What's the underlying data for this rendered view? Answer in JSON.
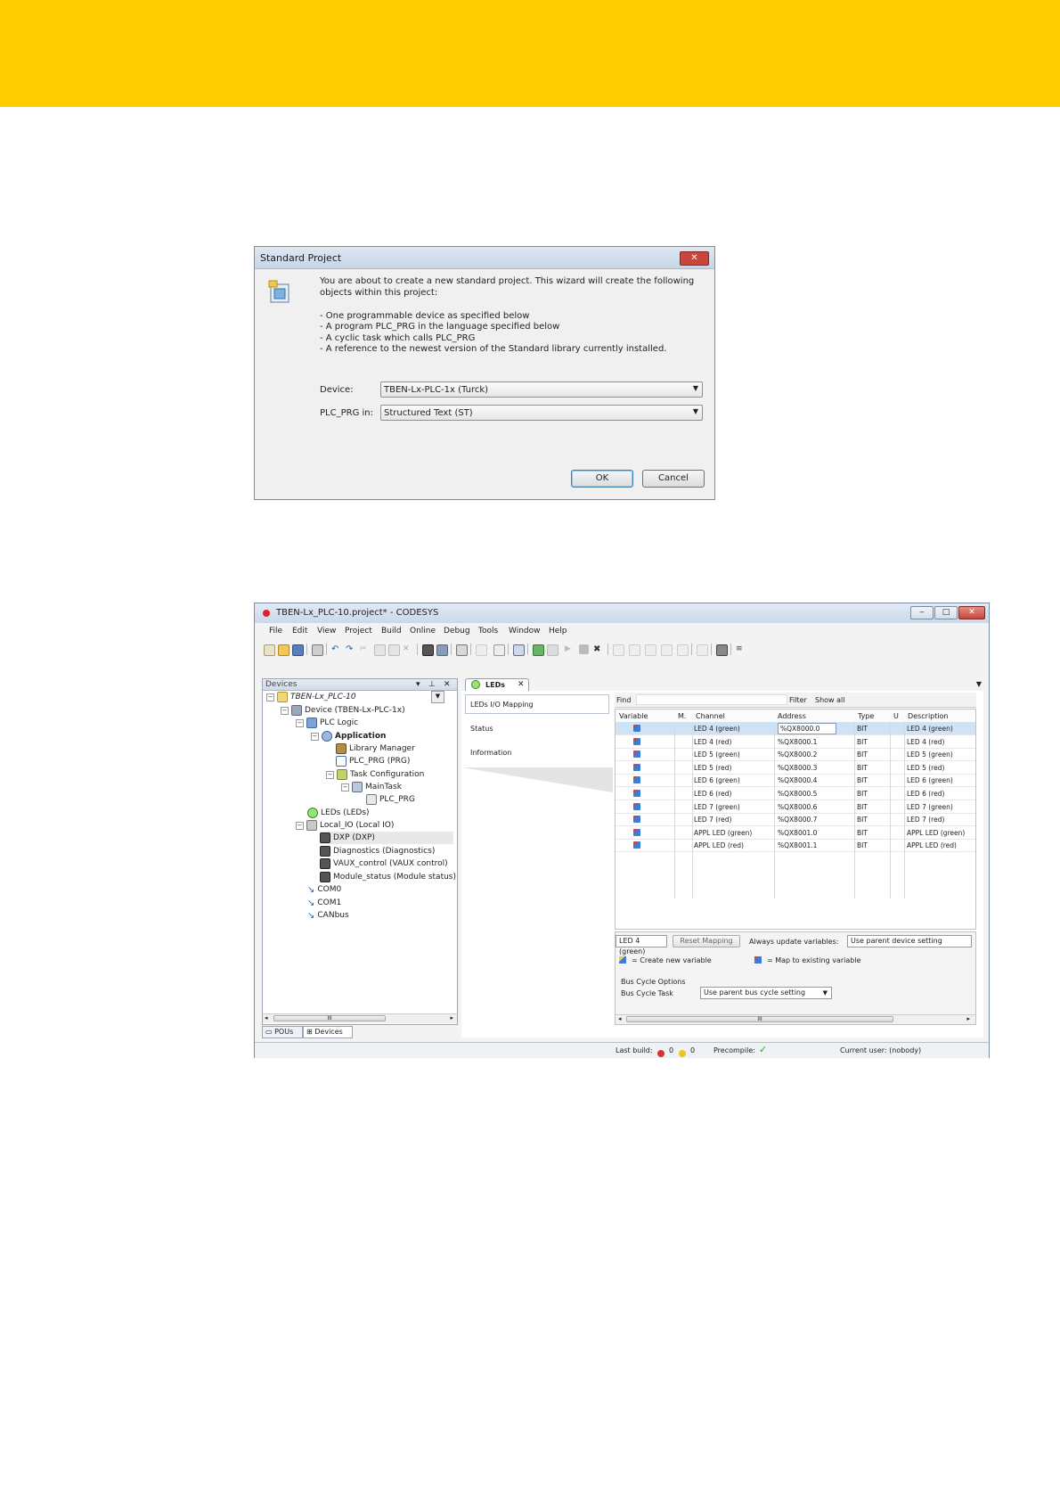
{
  "colors": {
    "banner": "#ffcc00",
    "accent": "#3c7fb1",
    "close": "#c9463d"
  },
  "dialog": {
    "title": "Standard Project",
    "close_label": "✕",
    "intro_1": "You are about to create a new standard project. This wizard will create the following",
    "intro_2": "objects within this project:",
    "bullet_1": "- One programmable device as specified below",
    "bullet_2": "- A program PLC_PRG in the language specified below",
    "bullet_3": "- A cyclic task which calls PLC_PRG",
    "bullet_4": "- A reference to the newest version of the Standard library currently installed.",
    "device_label": "Device:",
    "device_value": "TBEN-Lx-PLC-1x (Turck)",
    "plcprg_label": "PLC_PRG in:",
    "plcprg_value": "Structured Text (ST)",
    "ok_label": "OK",
    "cancel_label": "Cancel"
  },
  "codesys": {
    "title": "TBEN-Lx_PLC-10.project* - CODESYS",
    "menu": [
      "File",
      "Edit",
      "View",
      "Project",
      "Build",
      "Online",
      "Debug",
      "Tools",
      "Window",
      "Help"
    ],
    "devices_pane": {
      "title": "Devices",
      "tree": [
        "TBEN-Lx_PLC-10",
        "Device (TBEN-Lx-PLC-1x)",
        "PLC Logic",
        "Application",
        "Library Manager",
        "PLC_PRG (PRG)",
        "Task Configuration",
        "MainTask",
        "PLC_PRG",
        "LEDs (LEDs)",
        "Local_IO (Local IO)",
        "DXP (DXP)",
        "Diagnostics (Diagnostics)",
        "VAUX_control (VAUX control)",
        "Module_status (Module status)",
        "COM0",
        "COM1",
        "CANbus"
      ],
      "scroll_mark": "III",
      "tab_pous": "POUs",
      "tab_devices": "Devices"
    },
    "editor": {
      "tab": "LEDs",
      "nav": [
        "LEDs I/O Mapping",
        "Status",
        "Information"
      ],
      "find_label": "Find",
      "filter_label": "Filter",
      "filter_value": "Show all",
      "columns": [
        "Variable",
        "M.",
        "Channel",
        "Address",
        "Type",
        "U",
        "Description"
      ],
      "rows": [
        {
          "channel": "LED 4 (green)",
          "address": "%QX8000.0",
          "type": "BIT",
          "description": "LED 4 (green)"
        },
        {
          "channel": "LED 4 (red)",
          "address": "%QX8000.1",
          "type": "BIT",
          "description": "LED 4 (red)"
        },
        {
          "channel": "LED 5 (green)",
          "address": "%QX8000.2",
          "type": "BIT",
          "description": "LED 5 (green)"
        },
        {
          "channel": "LED 5 (red)",
          "address": "%QX8000.3",
          "type": "BIT",
          "description": "LED 5 (red)"
        },
        {
          "channel": "LED 6 (green)",
          "address": "%QX8000.4",
          "type": "BIT",
          "description": "LED 6 (green)"
        },
        {
          "channel": "LED 6 (red)",
          "address": "%QX8000.5",
          "type": "BIT",
          "description": "LED 6 (red)"
        },
        {
          "channel": "LED 7 (green)",
          "address": "%QX8000.6",
          "type": "BIT",
          "description": "LED 7 (green)"
        },
        {
          "channel": "LED 7 (red)",
          "address": "%QX8000.7",
          "type": "BIT",
          "description": "LED 7 (red)"
        },
        {
          "channel": "APPL LED (green)",
          "address": "%QX8001.0",
          "type": "BIT",
          "description": "APPL LED (green)"
        },
        {
          "channel": "APPL LED (red)",
          "address": "%QX8001.1",
          "type": "BIT",
          "description": "APPL LED (red)"
        }
      ],
      "selected_channel": "LED 4 (green)",
      "reset_mapping": "Reset Mapping",
      "always_update_label": "Always update variables:",
      "always_update_value": "Use parent device setting",
      "create_new_var": "= Create new variable",
      "map_existing_var": "= Map to existing variable",
      "bus_cycle_options": "Bus Cycle Options",
      "bus_cycle_task_label": "Bus Cycle Task",
      "bus_cycle_task_value": "Use parent bus cycle setting",
      "scroll_mark": "III"
    },
    "status": {
      "last_build_label": "Last build:",
      "errors": "0",
      "warnings": "0",
      "precompile_label": "Precompile:",
      "precompile_mark": "✓",
      "current_user": "Current user: (nobody)"
    }
  }
}
